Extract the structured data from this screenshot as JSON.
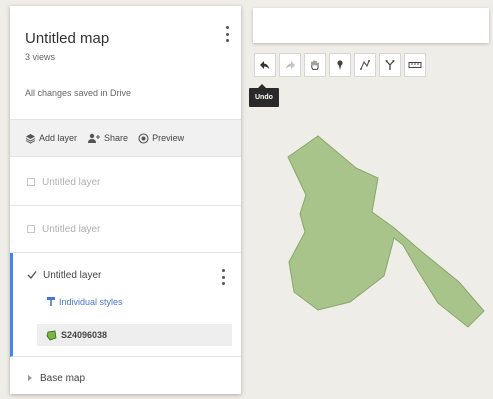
{
  "colors": {
    "map_background": "#efede8",
    "polygon_fill": "#a9c48b",
    "polygon_stroke": "#8aa66c",
    "accent_blue": "#4285f4",
    "link_blue": "#4a77c9",
    "feature_icon_green": "#7cb342"
  },
  "panel": {
    "title": "Untitled map",
    "views": "3 views",
    "save_status": "All changes saved in Drive",
    "menu_icon": "more-vert-icon",
    "actions": [
      {
        "label": "Add layer",
        "icon": "add-layer-icon"
      },
      {
        "label": "Share",
        "icon": "person-add-icon"
      },
      {
        "label": "Preview",
        "icon": "preview-eye-icon"
      }
    ],
    "layers": [
      {
        "name": "Untitled layer",
        "checked": false
      },
      {
        "name": "Untitled layer",
        "checked": false
      }
    ],
    "active_layer": {
      "name": "Untitled layer",
      "checked": true,
      "style_link": "Individual styles",
      "features": [
        {
          "name": "S24096038",
          "icon": "polygon-feature-icon"
        }
      ]
    },
    "base_map": "Base map"
  },
  "search": {
    "value": "",
    "placeholder": ""
  },
  "toolbar": {
    "tools": [
      {
        "name": "undo",
        "icon": "undo-icon"
      },
      {
        "name": "redo",
        "icon": "redo-icon"
      },
      {
        "name": "pan",
        "icon": "hand-icon"
      },
      {
        "name": "add-marker",
        "icon": "marker-icon"
      },
      {
        "name": "draw-line",
        "icon": "draw-line-icon"
      },
      {
        "name": "directions",
        "icon": "directions-icon"
      },
      {
        "name": "measure",
        "icon": "ruler-icon"
      }
    ],
    "tooltip": "Undo"
  }
}
